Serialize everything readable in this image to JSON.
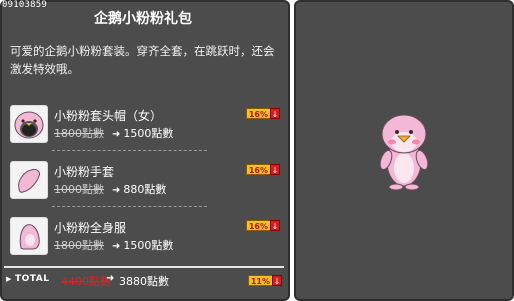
{
  "item_id": "09103859",
  "title": "企鹅小粉粉礼包",
  "description": "可爱的企鹅小粉粉套装。穿齐全套，在跳跃时，还会激发特效哦。",
  "items": [
    {
      "name": "小粉粉套头帽（女）",
      "old_price": "1800點數",
      "new_price": "1500點數",
      "discount": "16%",
      "icon": "penguin-hat-icon"
    },
    {
      "name": "小粉粉手套",
      "old_price": "1000點數",
      "new_price": "880點數",
      "discount": "16%",
      "icon": "pink-glove-icon"
    },
    {
      "name": "小粉粉全身服",
      "old_price": "1800點數",
      "new_price": "1500點數",
      "discount": "16%",
      "icon": "pink-suit-icon"
    }
  ],
  "total": {
    "label": "TOTAL",
    "old_price": "4400點數",
    "new_price": "3880點數",
    "discount": "11%"
  },
  "arrow_glyph": "➜",
  "down_glyph": "↓",
  "bullet_glyph": "▶",
  "colors": {
    "panel_bg": "#4c4c4c",
    "badge_bg": "#f4c21c",
    "down_bg": "#d31f22",
    "total_old": "#e02020",
    "character_pink": "#f2b8d6"
  }
}
